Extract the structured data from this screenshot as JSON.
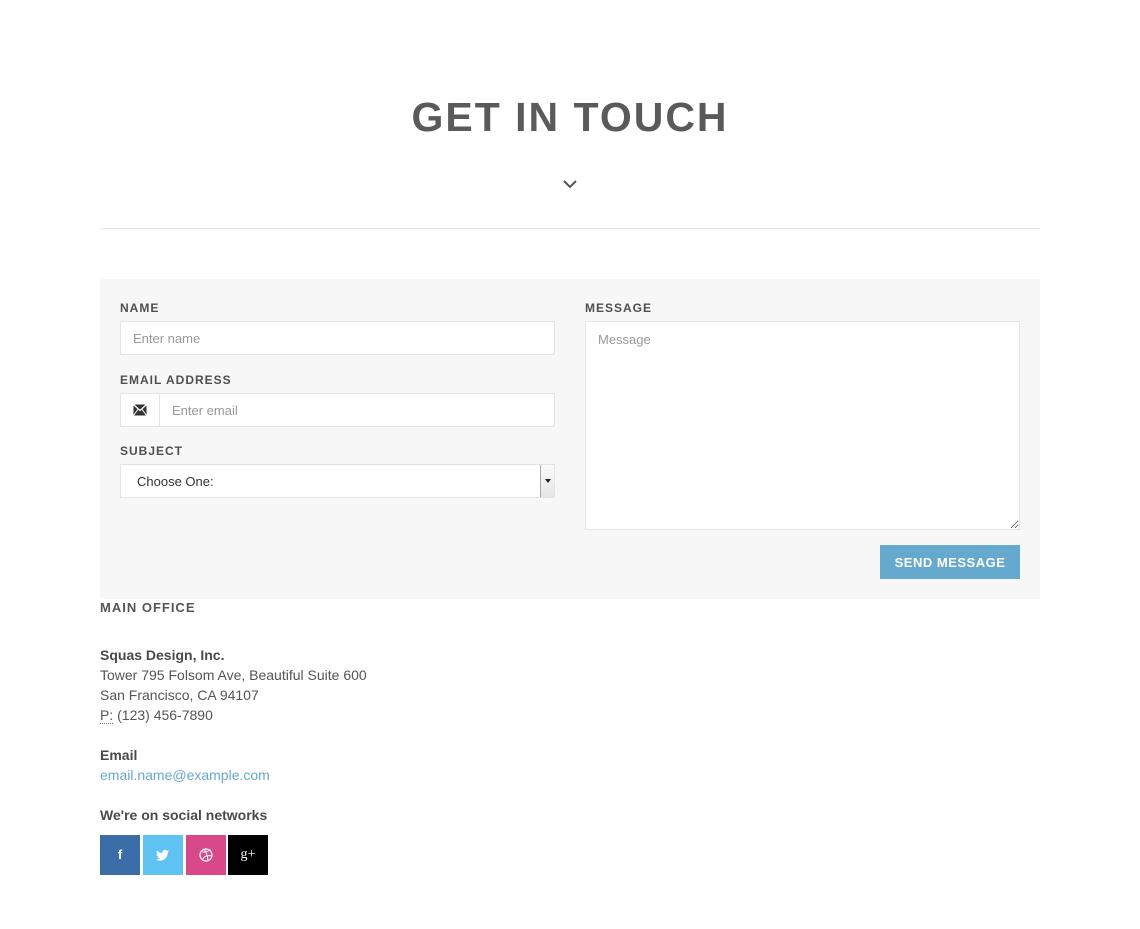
{
  "page_title": "GET IN TOUCH",
  "chevron_icon": "chevron-down-icon",
  "form": {
    "name_label": "NAME",
    "name_placeholder": "Enter name",
    "email_label": "EMAIL ADDRESS",
    "email_icon": "envelope-icon",
    "email_placeholder": "Enter email",
    "subject_label": "SUBJECT",
    "subject_value": "Choose One:",
    "message_label": "MESSAGE",
    "message_placeholder": "Message",
    "send_label": "SEND MESSAGE"
  },
  "office": {
    "heading": "MAIN OFFICE",
    "company": "Squas Design, Inc.",
    "address_line1": "Tower 795 Folsom Ave, Beautiful Suite 600",
    "address_line2": "San Francisco, CA 94107",
    "phone_label": "P:",
    "phone": "(123) 456-7890",
    "email_heading": "Email",
    "email": "email.name@example.com",
    "social_heading": "We're on social networks"
  },
  "socials": [
    {
      "icon": "facebook-icon",
      "glyph": "f",
      "color": "#3b6da8"
    },
    {
      "icon": "twitter-icon",
      "glyph": "",
      "color": "#5ec2f2"
    },
    {
      "icon": "dribbble-icon",
      "glyph": "",
      "color": "#d9498a"
    },
    {
      "icon": "google-plus-icon",
      "glyph": "g+",
      "color": "#000000"
    }
  ],
  "colors": {
    "accent": "#65a9cf",
    "title": "#5a5a5a",
    "panel_bg": "#f7f7f7"
  }
}
